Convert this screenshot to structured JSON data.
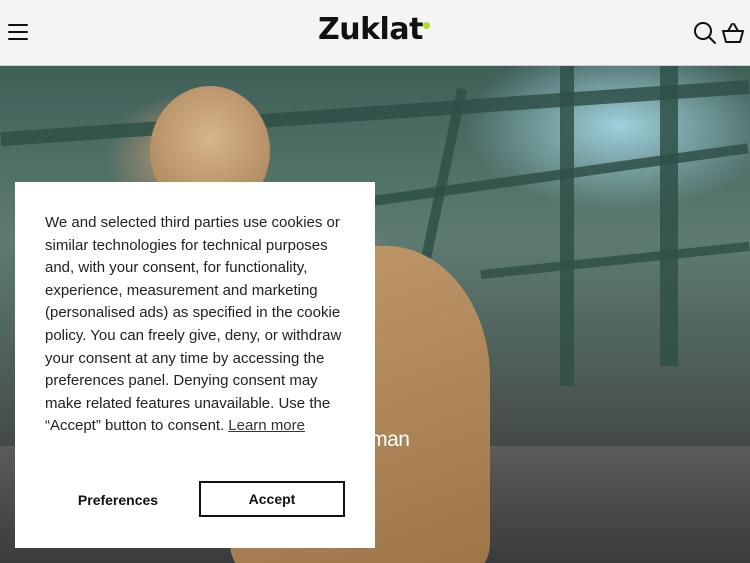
{
  "header": {
    "logo": "Zuklat",
    "menu_icon": "hamburger-menu-icon",
    "search_icon": "search-icon",
    "cart_icon": "basket-icon",
    "accent_color": "#a6e22e"
  },
  "hero": {
    "link_label": "Woman"
  },
  "cookie_banner": {
    "message": "We and selected third parties use cookies or similar technologies for technical purposes and, with your consent, for functionality, experience, measurement and marketing (personalised ads) as specified in the cookie policy. You can freely give, deny, or withdraw your consent at any time by accessing the preferences panel. Denying consent may make related features unavailable. Use the “Accept” button to consent.",
    "learn_more": "Learn more",
    "preferences_label": "Preferences",
    "accept_label": "Accept"
  }
}
